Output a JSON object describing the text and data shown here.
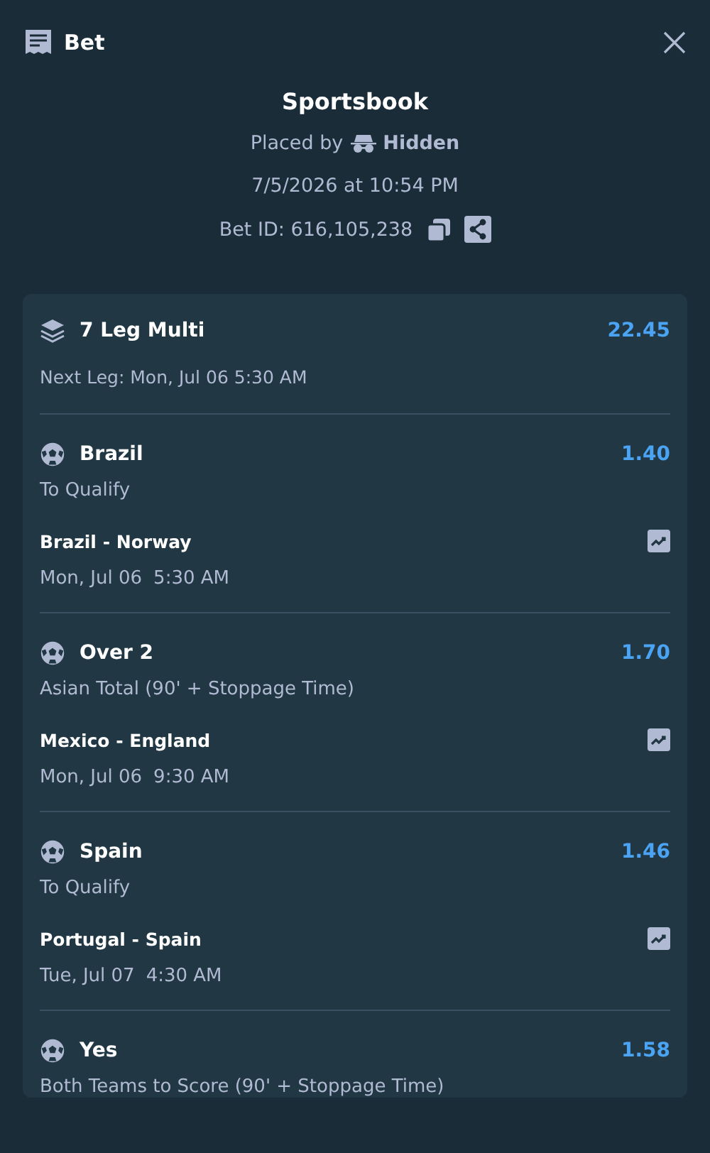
{
  "header": {
    "title": "Bet"
  },
  "summary": {
    "source": "Sportsbook",
    "placed_by_label": "Placed by",
    "placed_by": "Hidden",
    "placed_at": "7/5/2026 at 10:54 PM",
    "bet_id": "Bet ID: 616,105,238"
  },
  "multi": {
    "title": "7 Leg Multi",
    "odds": "22.45",
    "next_leg": "Next Leg: Mon, Jul 06 5:30 AM"
  },
  "legs": [
    {
      "selection": "Brazil",
      "odds": "1.40",
      "market": "To Qualify",
      "match": "Brazil - Norway",
      "date": "Mon, Jul 06",
      "time": "5:30 AM"
    },
    {
      "selection": "Over 2",
      "odds": "1.70",
      "market": "Asian Total (90' + Stoppage Time)",
      "match": "Mexico - England",
      "date": "Mon, Jul 06",
      "time": "9:30 AM"
    },
    {
      "selection": "Spain",
      "odds": "1.46",
      "market": "To Qualify",
      "match": "Portugal - Spain",
      "date": "Tue, Jul 07",
      "time": "4:30 AM"
    },
    {
      "selection": "Yes",
      "odds": "1.58",
      "market": "Both Teams to Score (90' + Stoppage Time)"
    }
  ]
}
